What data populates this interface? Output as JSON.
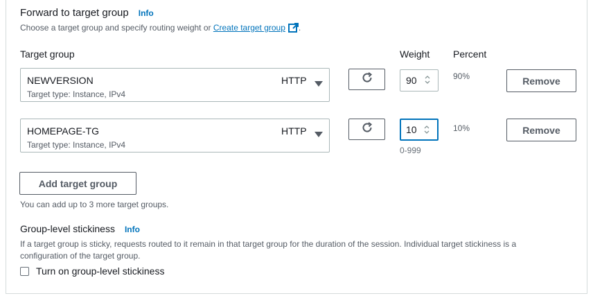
{
  "forward": {
    "title": "Forward to target group",
    "info": "Info",
    "description_prefix": "Choose a target group and specify routing weight or ",
    "create_link": "Create target group",
    "description_suffix": "."
  },
  "columns": {
    "target_group": "Target group",
    "weight": "Weight",
    "percent": "Percent"
  },
  "rows": [
    {
      "name": "NEWVERSION",
      "type_text": "Target type: Instance, IPv4",
      "protocol": "HTTP",
      "weight": "90",
      "percent": "90%",
      "remove_label": "Remove"
    },
    {
      "name": "HOMEPAGE-TG",
      "type_text": "Target type: Instance, IPv4",
      "protocol": "HTTP",
      "weight": "10",
      "percent": "10%",
      "remove_label": "Remove"
    }
  ],
  "weight_range": "0-999",
  "add_button": "Add target group",
  "add_hint": "You can add up to 3 more target groups.",
  "stickiness": {
    "title": "Group-level stickiness",
    "info": "Info",
    "description_line1": "If a target group is sticky, requests routed to it remain in that target group for the duration of the session. Individual target stickiness is a",
    "description_line2": "configuration of the target group.",
    "checkbox_label": "Turn on group-level stickiness",
    "checked": false
  },
  "colors": {
    "link": "#0073bb",
    "focus": "#0073bb",
    "text": "#16191f",
    "muted": "#545b64"
  }
}
